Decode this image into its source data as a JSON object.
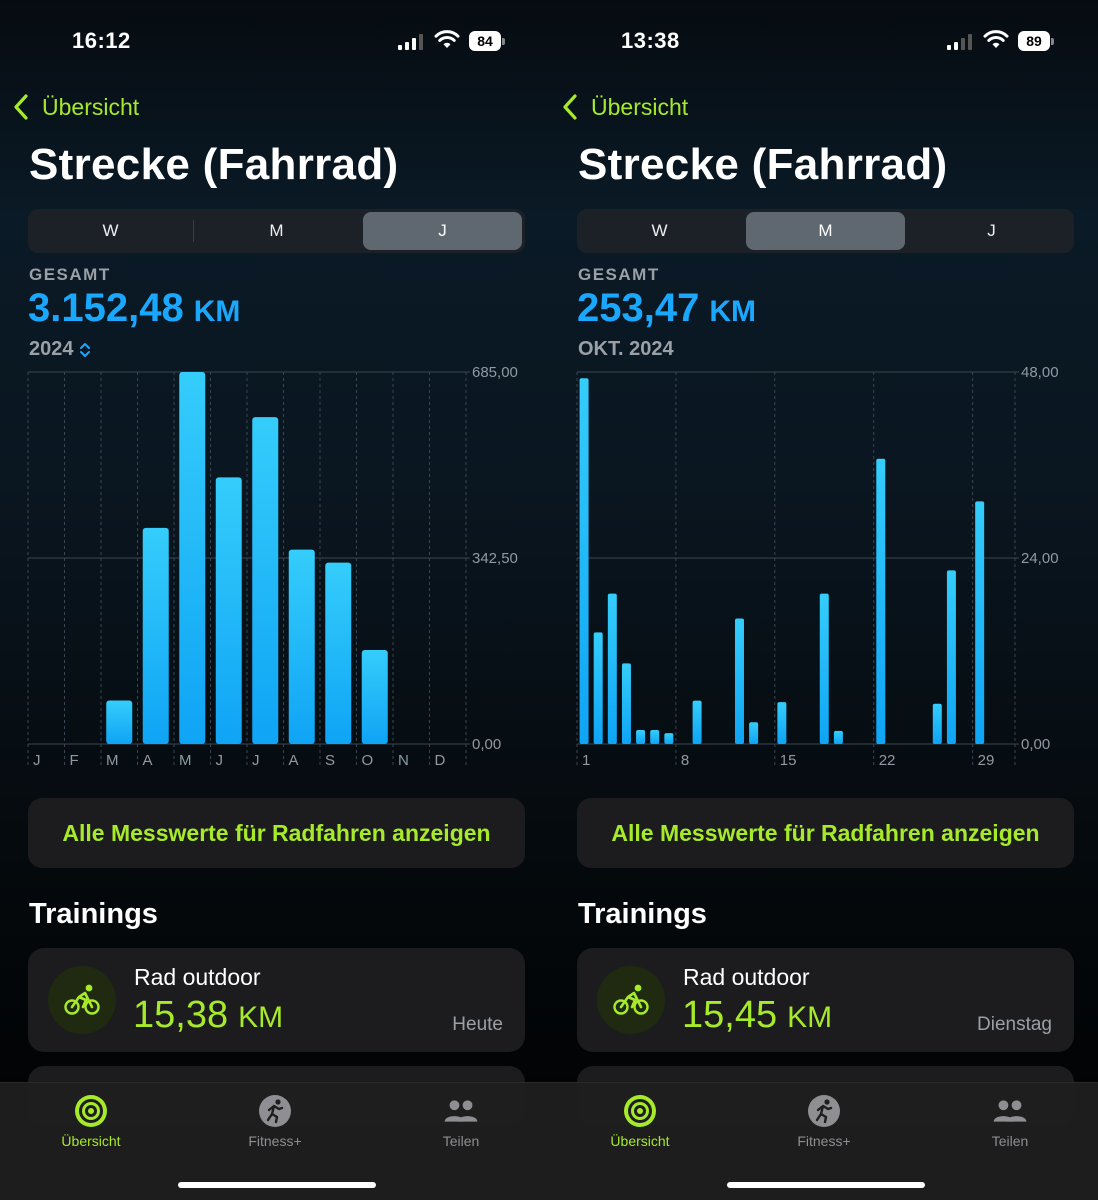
{
  "colors": {
    "accent_green": "#a6ea2a",
    "accent_blue": "#1aa8ff",
    "bar_top": "#35cdfb",
    "bar_bottom": "#0fa4f5"
  },
  "screens": [
    {
      "status": {
        "time": "16:12",
        "battery": "84"
      },
      "back_label": "Übersicht",
      "title": "Strecke (Fahrrad)",
      "segments": [
        "W",
        "M",
        "J"
      ],
      "selected_segment": "J",
      "total_label": "GESAMT",
      "total_value": "3.152,48",
      "total_unit": "KM",
      "period": "2024",
      "period_has_chevron": true,
      "all_metrics_button": "Alle Messwerte für Radfahren anzeigen",
      "section_title": "Trainings",
      "workout": {
        "icon": "bicycle-icon",
        "name": "Rad outdoor",
        "distance": "15,38",
        "unit": "KM",
        "when": "Heute"
      },
      "tabs": [
        {
          "label": "Übersicht",
          "icon": "activity-rings-icon",
          "active": true
        },
        {
          "label": "Fitness+",
          "icon": "fitness-runner-icon",
          "active": false
        },
        {
          "label": "Teilen",
          "icon": "people-icon",
          "active": false
        }
      ],
      "chart_data": {
        "type": "bar",
        "categories": [
          "J",
          "F",
          "M",
          "A",
          "M",
          "J",
          "J",
          "A",
          "S",
          "O",
          "N",
          "D"
        ],
        "values": [
          0,
          0,
          80,
          398,
          685,
          491,
          602,
          358,
          334,
          173,
          0,
          0
        ],
        "x_tick_labels": [
          "J",
          "F",
          "M",
          "A",
          "M",
          "J",
          "J",
          "A",
          "S",
          "O",
          "N",
          "D"
        ],
        "y_tick_labels": [
          "685,00",
          "342,50",
          "0,00"
        ],
        "ylim": [
          0,
          685
        ],
        "grid": true
      }
    },
    {
      "status": {
        "time": "13:38",
        "battery": "89"
      },
      "back_label": "Übersicht",
      "title": "Strecke (Fahrrad)",
      "segments": [
        "W",
        "M",
        "J"
      ],
      "selected_segment": "M",
      "total_label": "GESAMT",
      "total_value": "253,47",
      "total_unit": "KM",
      "period": "OKT. 2024",
      "period_has_chevron": false,
      "all_metrics_button": "Alle Messwerte für Radfahren anzeigen",
      "section_title": "Trainings",
      "workout": {
        "icon": "bicycle-icon",
        "name": "Rad outdoor",
        "distance": "15,45",
        "unit": "KM",
        "when": "Dienstag"
      },
      "tabs": [
        {
          "label": "Übersicht",
          "icon": "activity-rings-icon",
          "active": true
        },
        {
          "label": "Fitness+",
          "icon": "fitness-runner-icon",
          "active": false
        },
        {
          "label": "Teilen",
          "icon": "people-icon",
          "active": false
        }
      ],
      "chart_data": {
        "type": "bar",
        "categories": [
          "1",
          "2",
          "3",
          "4",
          "5",
          "6",
          "7",
          "8",
          "9",
          "10",
          "11",
          "12",
          "13",
          "14",
          "15",
          "16",
          "17",
          "18",
          "19",
          "20",
          "21",
          "22",
          "23",
          "24",
          "25",
          "26",
          "27",
          "28",
          "29",
          "30",
          "31"
        ],
        "values": [
          47.2,
          14.4,
          19.4,
          10.4,
          1.8,
          1.8,
          1.4,
          0,
          5.6,
          0,
          0,
          16.2,
          2.8,
          0,
          5.4,
          0,
          0,
          19.4,
          1.7,
          0,
          0,
          36.8,
          0,
          0,
          0,
          5.2,
          22.4,
          0,
          31.3,
          0,
          0
        ],
        "x_tick_labels": [
          "1",
          "8",
          "15",
          "22",
          "29"
        ],
        "y_tick_labels": [
          "48,00",
          "24,00",
          "0,00"
        ],
        "ylim": [
          0,
          48
        ],
        "grid": true
      }
    }
  ]
}
